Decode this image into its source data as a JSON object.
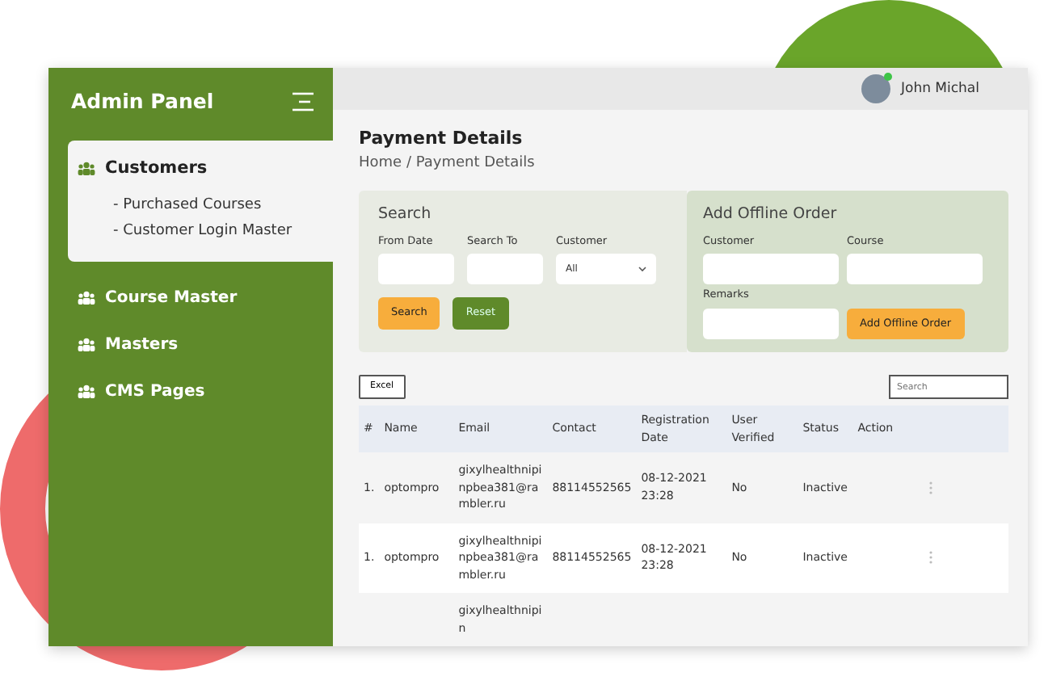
{
  "sidebar": {
    "title": "Admin Panel",
    "items": [
      {
        "label": "Customers",
        "selected": true,
        "children": [
          {
            "label": "- Purchased Courses"
          },
          {
            "label": "- Customer Login Master"
          }
        ]
      },
      {
        "label": "Course Master",
        "selected": false
      },
      {
        "label": "Masters",
        "selected": false
      },
      {
        "label": "CMS Pages",
        "selected": false
      }
    ]
  },
  "user": {
    "name": "John Michal",
    "online": true
  },
  "page": {
    "title": "Payment Details",
    "breadcrumb": "Home / Payment Details"
  },
  "search_panel": {
    "title": "Search",
    "fields": [
      {
        "label": "From Date",
        "kind": "input"
      },
      {
        "label": "Search To",
        "kind": "input"
      },
      {
        "label": "Customer",
        "kind": "select",
        "value": "All"
      }
    ],
    "buttons": [
      {
        "label": "Search",
        "kind": "primary"
      },
      {
        "label": "Reset",
        "kind": "secondary"
      }
    ]
  },
  "offline_order": {
    "title": "Add Offline Order",
    "fields": [
      {
        "label": "Customer"
      },
      {
        "label": "Course"
      },
      {
        "label": "Remarks"
      }
    ],
    "button": "Add Offline Order"
  },
  "table": {
    "export_button": "Excel",
    "search_placeholder": "Search",
    "columns": [
      "#",
      "Name",
      "Email",
      "Contact",
      "Registration Date",
      "User Verified",
      "Status",
      "Action"
    ],
    "rows": [
      {
        "index": "1.",
        "name": "optompro",
        "email": "gixylhealthnipinpbea381@rambler.ru",
        "contact": "88114552565",
        "date": "08-12-2021 23:28",
        "verified": "No",
        "status": "Inactive"
      },
      {
        "index": "1.",
        "name": "optompro",
        "email": "gixylhealthnipinpbea381@rambler.ru",
        "contact": "88114552565",
        "date": "08-12-2021 23:28",
        "verified": "No",
        "status": "Inactive"
      },
      {
        "email": "gixylhealthnipin"
      }
    ]
  }
}
